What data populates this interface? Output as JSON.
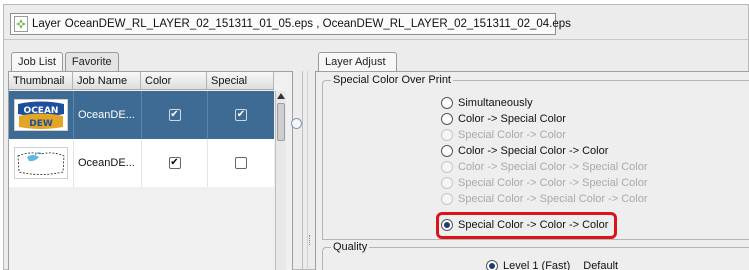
{
  "layer_bar": {
    "label": "Layer",
    "files": "OceanDEW_RL_LAYER_02_151311_01_05.eps , OceanDEW_RL_LAYER_02_151311_02_04.eps"
  },
  "left_tabs": [
    "Job List",
    "Favorite"
  ],
  "job_list": {
    "columns": [
      "Thumbnail",
      "Job Name",
      "Color",
      "Special"
    ],
    "rows": [
      {
        "job_name": "OceanDE...",
        "color": true,
        "special": true,
        "selected": true
      },
      {
        "job_name": "OceanDE...",
        "color": true,
        "special": false,
        "selected": false
      }
    ],
    "thumbnail_logo_text": "OCEAN DEW"
  },
  "right_tabs": [
    "Layer Adjust"
  ],
  "special_color_over_print": {
    "title": "Special Color Over Print",
    "options": [
      {
        "label": "Simultaneously",
        "enabled": true,
        "selected": false
      },
      {
        "label": "Color -> Special Color",
        "enabled": true,
        "selected": false
      },
      {
        "label": "Special Color -> Color",
        "enabled": false,
        "selected": false
      },
      {
        "label": "Color -> Special Color -> Color",
        "enabled": true,
        "selected": false
      },
      {
        "label": "Color -> Special Color -> Special Color",
        "enabled": false,
        "selected": false
      },
      {
        "label": "Special Color -> Color -> Special Color",
        "enabled": false,
        "selected": false
      },
      {
        "label": "Special Color -> Special Color -> Color",
        "enabled": false,
        "selected": false
      },
      {
        "label": "Special Color -> Color -> Color",
        "enabled": true,
        "selected": true
      }
    ]
  },
  "quality": {
    "title": "Quality",
    "option_label": "Level 1 (Fast)",
    "default_label": "Default"
  },
  "colors": {
    "selected_row": "#3d6b94",
    "highlight": "#d9151a"
  }
}
